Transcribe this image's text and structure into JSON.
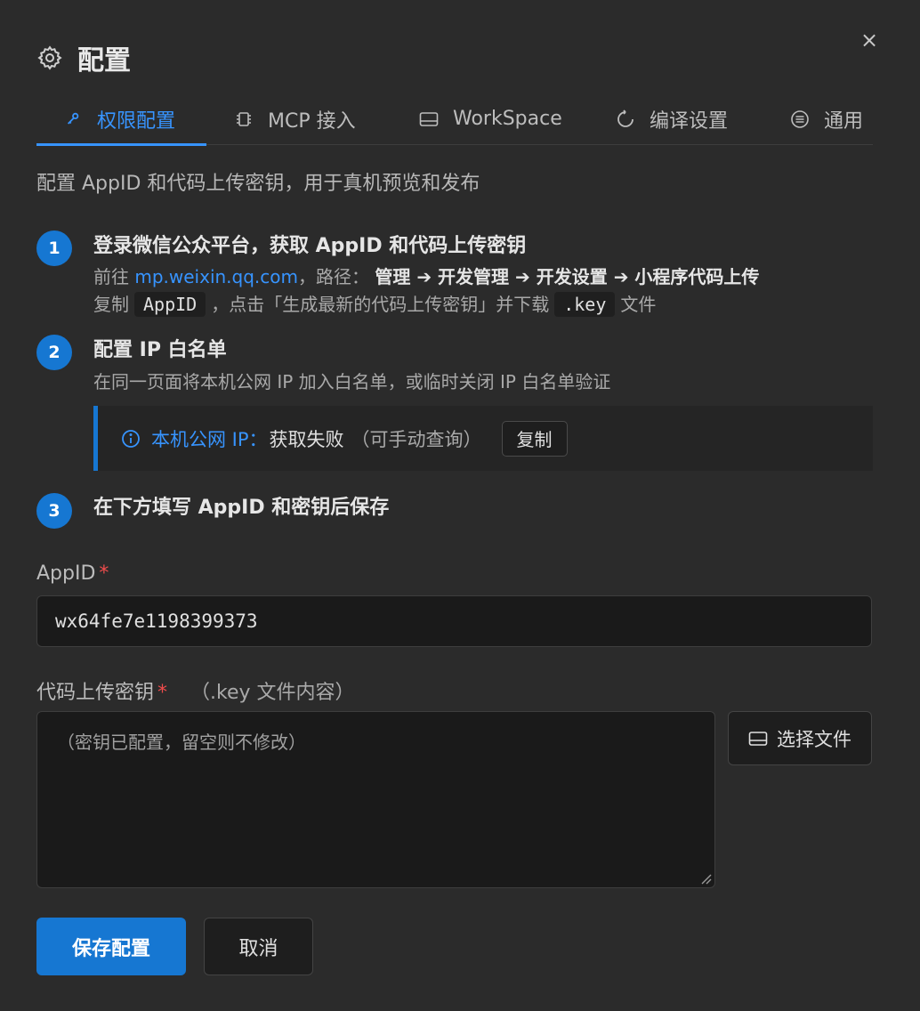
{
  "dialog": {
    "title": "配置",
    "close_label": "×"
  },
  "tabs": [
    {
      "label": "权限配置",
      "icon": "key-icon",
      "active": true
    },
    {
      "label": "MCP 接入",
      "icon": "chip-icon",
      "active": false
    },
    {
      "label": "WorkSpace",
      "icon": "folder-icon",
      "active": false
    },
    {
      "label": "编译设置",
      "icon": "refresh-icon",
      "active": false
    },
    {
      "label": "通用",
      "icon": "list-icon",
      "active": false
    }
  ],
  "intro": "配置 AppID 和代码上传密钥，用于真机预览和发布",
  "steps": [
    {
      "num": "1",
      "title": "登录微信公众平台，获取 AppID 和代码上传密钥",
      "line1_prefix": "前往 ",
      "line1_link": "mp.weixin.qq.com",
      "line1_mid": "，路径：",
      "line1_path": "管理 ➔ 开发管理 ➔ 开发设置 ➔ 小程序代码上传",
      "line2_a": "复制",
      "line2_code1": "AppID",
      "line2_b": "，点击「生成最新的代码上传密钥」并下载",
      "line2_code2": ".key",
      "line2_c": "文件"
    },
    {
      "num": "2",
      "title": "配置 IP 白名单",
      "line1": "在同一页面将本机公网 IP 加入白名单，或临时关闭 IP 白名单验证"
    },
    {
      "num": "3",
      "title": "在下方填写 AppID 和密钥后保存"
    }
  ],
  "ip_box": {
    "label": "本机公网 IP：",
    "value": "获取失败",
    "hint": "（可手动查询）",
    "copy_label": "复制"
  },
  "form": {
    "appid_label": "AppID",
    "required_mark": "*",
    "appid_value": "wx64fe7e1198399373",
    "key_label": "代码上传密钥",
    "key_note": "（.key 文件内容）",
    "key_placeholder": "（密钥已配置，留空则不修改）",
    "choose_file_label": "选择文件"
  },
  "actions": {
    "save_label": "保存配置",
    "cancel_label": "取消"
  },
  "colors": {
    "accent": "#1677d2",
    "link": "#3794ff",
    "required": "#f14c4c",
    "background": "#2b2b2b"
  }
}
